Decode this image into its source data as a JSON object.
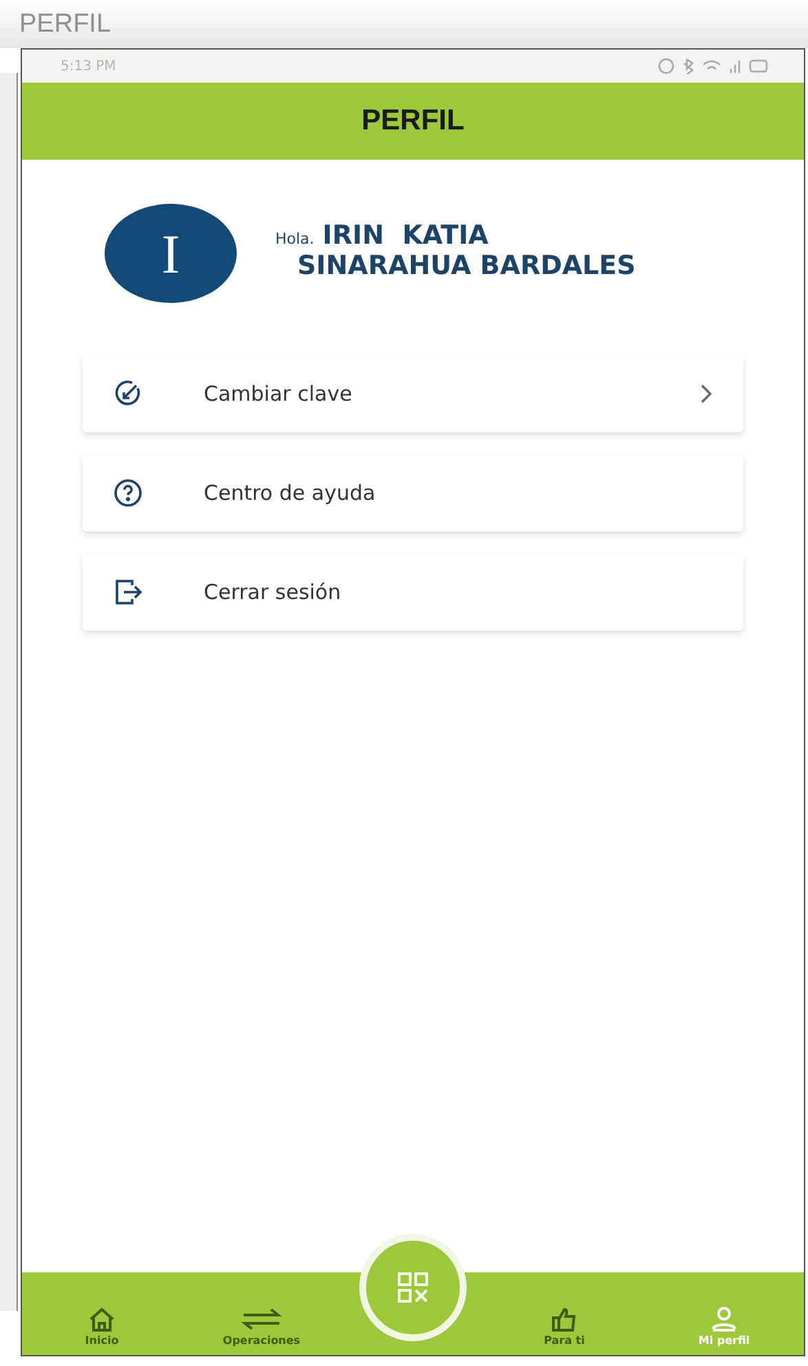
{
  "window": {
    "title": "PERFIL"
  },
  "status_bar": {
    "time": "5:13 PM"
  },
  "header": {
    "title": "PERFIL"
  },
  "profile": {
    "initial": "I",
    "greeting": "Hola.",
    "name_line_1": "IRIN  KATIA",
    "name_line_2": "SINARAHUA BARDALES"
  },
  "menu": [
    {
      "kind": "edit",
      "label": "Cambiar clave",
      "chevron": true
    },
    {
      "kind": "help",
      "label": "Centro de ayuda",
      "chevron": false
    },
    {
      "kind": "logout",
      "label": "Cerrar sesión",
      "chevron": false
    }
  ],
  "nav": [
    {
      "kind": "home",
      "label": "Inicio",
      "selected": false
    },
    {
      "kind": "swap",
      "label": "Operaciones",
      "selected": false
    },
    {
      "kind": "qr",
      "selected": false
    },
    {
      "kind": "like",
      "label": "Para ti",
      "selected": false
    },
    {
      "kind": "user",
      "label": "Mi perfil",
      "selected": true
    }
  ]
}
